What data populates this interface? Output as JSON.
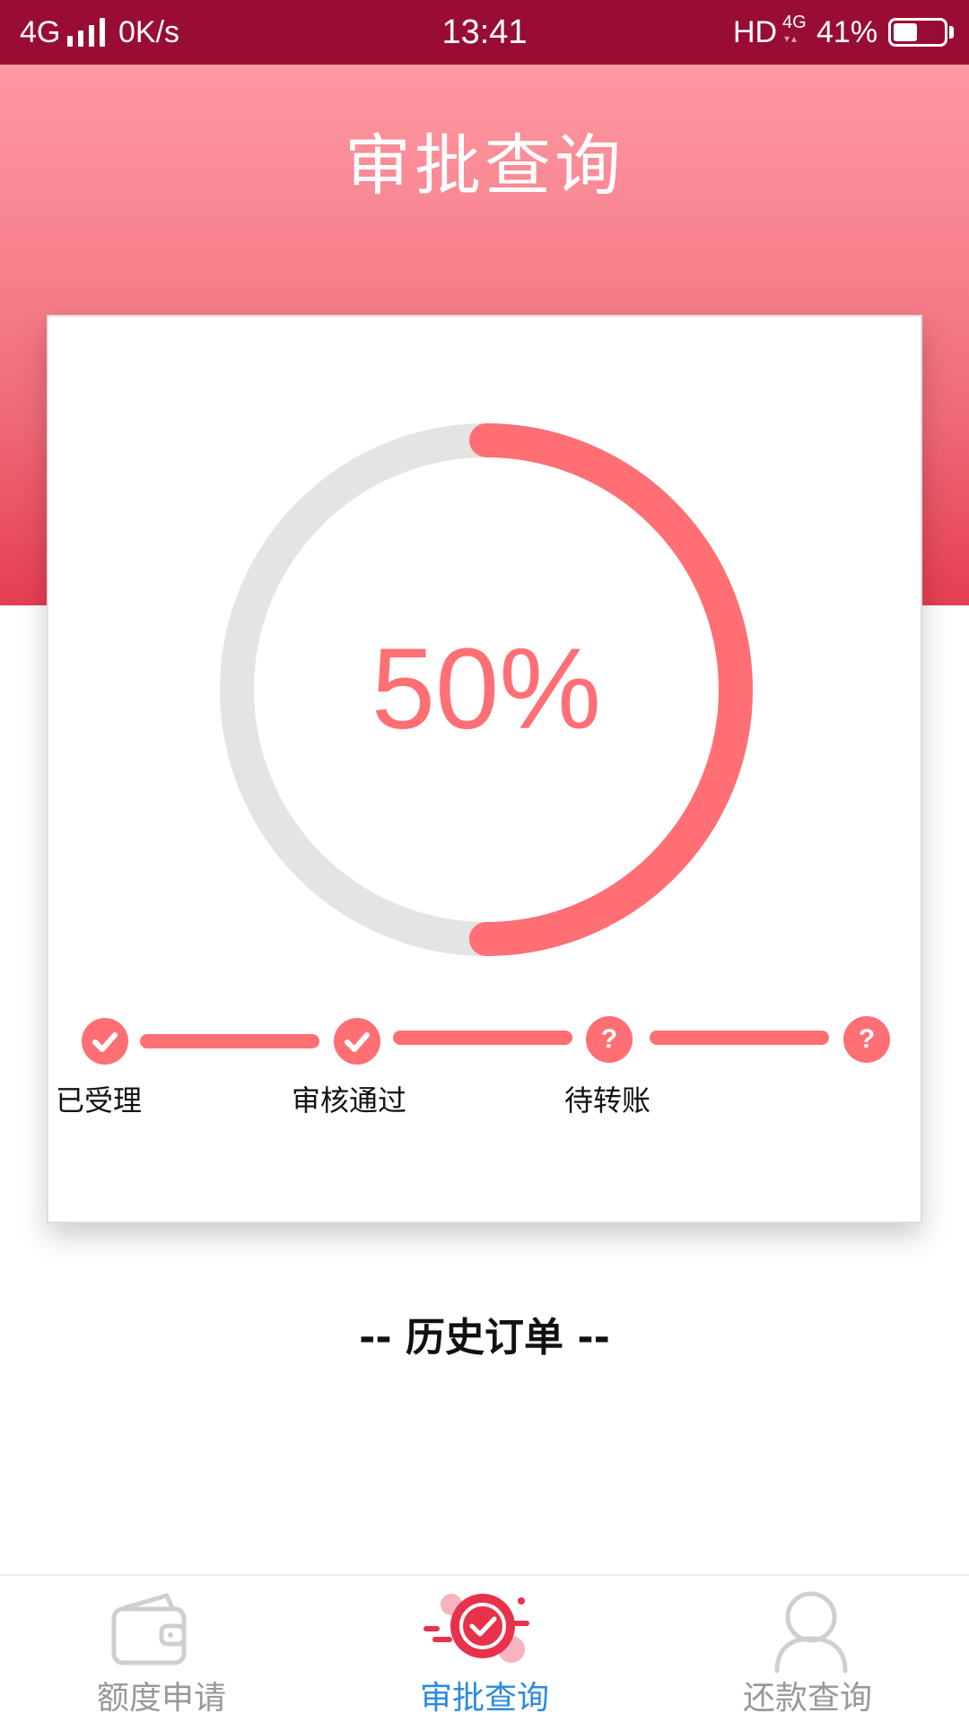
{
  "status_bar": {
    "network": "4G",
    "speed": "0K/s",
    "time": "13:41",
    "hd": "HD",
    "network_small": "4G",
    "battery_percent": "41%",
    "battery_level": 0.41,
    "background_color": "#990d35"
  },
  "header": {
    "title": "审批查询"
  },
  "progress": {
    "percent_text": "50%",
    "value": 0.5,
    "accent_color": "#ff6f74",
    "track_color": "#e4e4e4",
    "steps": [
      {
        "label": "已受理",
        "status": "done",
        "icon": "check-icon"
      },
      {
        "label": "审核通过",
        "status": "done",
        "icon": "check-icon"
      },
      {
        "label": "待转账",
        "status": "pending",
        "icon": "question-icon",
        "symbol": "?"
      },
      {
        "label": "",
        "status": "pending",
        "icon": "question-icon",
        "symbol": "?"
      }
    ]
  },
  "history": {
    "title": "-- 历史订单 --"
  },
  "tabs": [
    {
      "label": "额度申请",
      "icon": "wallet-icon",
      "active": false
    },
    {
      "label": "审批查询",
      "icon": "approval-check-icon",
      "active": true
    },
    {
      "label": "还款查询",
      "icon": "user-icon",
      "active": false
    }
  ],
  "colors": {
    "tab_active": "#2c8cdc",
    "tab_inactive": "#999999"
  }
}
